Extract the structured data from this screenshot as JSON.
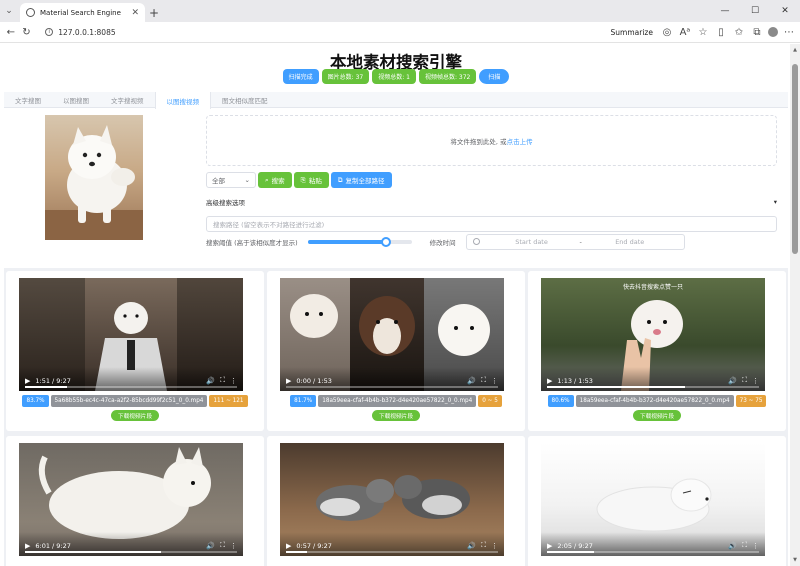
{
  "browser": {
    "tab_title": "Material Search Engine",
    "url": "127.0.0.1:8085",
    "summarize_label": "Summarize"
  },
  "app": {
    "title": "本地素材搜索引擎",
    "stats": [
      {
        "label": "扫描完成",
        "color": "blue"
      },
      {
        "label": "图片总数: 37",
        "color": "green"
      },
      {
        "label": "视频总数: 1",
        "color": "green"
      },
      {
        "label": "视频帧总数: 372",
        "color": "green"
      },
      {
        "label": "扫描",
        "color": "blue-round"
      }
    ],
    "tabs": [
      "文字搜图",
      "以图搜图",
      "文字搜视频",
      "以图搜视频",
      "图文相似度匹配"
    ],
    "active_tab": 3
  },
  "search": {
    "upload_text": "将文件拖到此处, 或",
    "upload_link": "点击上传",
    "filter_select": "全部",
    "search_button": "搜索",
    "paste_button": "粘贴",
    "copy_paths_button": "复制全部路径",
    "advanced_label": "高级搜索选项",
    "path_placeholder": "搜索路径 (留空表示不对路径进行过滤)",
    "threshold_label": "搜索阈值 (高于该相似度才显示)",
    "threshold_value": 0.75,
    "date_label": "修改时间",
    "date_start_placeholder": "Start date",
    "date_end_placeholder": "End date",
    "date_separator": "-"
  },
  "results": [
    {
      "time": "1:51 / 9:27",
      "progress": 0.2,
      "score": "83.7%",
      "file": "5a68b55b-ec4c-47ca-a2f2-85bcdd99f2c51_0_0.mp4",
      "range": "111 ~ 121",
      "download": "下载视频片段",
      "overlay": ""
    },
    {
      "time": "0:00 / 1:53",
      "progress": 0.0,
      "score": "81.7%",
      "file": "18a59eea-cfaf-4b4b-b372-d4e420ae57822_0_0.mp4",
      "range": "0 ~ 5",
      "download": "下载视频片段",
      "overlay": ""
    },
    {
      "time": "1:13 / 1:53",
      "progress": 0.65,
      "score": "80.6%",
      "file": "18a59eea-cfaf-4b4b-b372-d4e420ae57822_0_0.mp4",
      "range": "73 ~ 75",
      "download": "下载视频片段",
      "overlay": "快去抖音搜索点赞一只"
    },
    {
      "time": "6:01 / 9:27",
      "progress": 0.64,
      "score": "",
      "file": "",
      "range": "",
      "download": "",
      "overlay": ""
    },
    {
      "time": "0:57 / 9:27",
      "progress": 0.1,
      "score": "",
      "file": "",
      "range": "",
      "download": "",
      "overlay": ""
    },
    {
      "time": "2:05 / 9:27",
      "progress": 0.22,
      "score": "",
      "file": "",
      "range": "",
      "download": "",
      "overlay": ""
    }
  ]
}
